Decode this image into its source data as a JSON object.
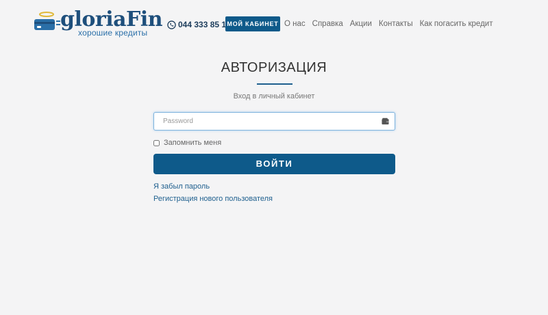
{
  "header": {
    "logo_text": "gloriaFin",
    "logo_tagline": "хорошие кредиты",
    "phone": "044 333 85 10",
    "cabinet_button": "МОЙ КАБИНЕТ",
    "nav": [
      "О нас",
      "Справка",
      "Акции",
      "Контакты",
      "Как погасить кредит"
    ]
  },
  "auth": {
    "title": "АВТОРИЗАЦИЯ",
    "subtitle": "Вход в личный кабинет",
    "password_placeholder": "Password",
    "password_value": "",
    "remember_label": "Запомнить меня",
    "remember_checked": false,
    "submit_label": "ВОЙТИ",
    "forgot_link": "Я забыл пароль",
    "register_link": "Регистрация нового пользователя"
  },
  "icons": {
    "logo": "card-with-halo-icon",
    "phone": "phone-icon",
    "password_field": "wallet-icon"
  },
  "colors": {
    "brand_dark": "#1e4f7c",
    "brand_light": "#2a6fa8",
    "button": "#0e5a8a",
    "background": "#f4f4f5"
  }
}
